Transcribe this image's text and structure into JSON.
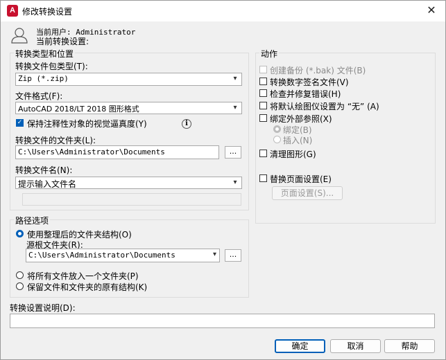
{
  "window": {
    "title": "修改转换设置",
    "app_icon_letter": "A",
    "close_glyph": "✕"
  },
  "user": {
    "current_user": "当前用户: Administrator",
    "current_setting": "当前转换设置:"
  },
  "left": {
    "group_title": "转换类型和位置",
    "package_type_label": "转换文件包类型(T):",
    "package_type_value": "Zip (*.zip)",
    "file_format_label": "文件格式(F):",
    "file_format_value": "AutoCAD 2018/LT 2018 图形格式",
    "keep_annotative_label": "保持注释性对象的视觉逼真度(Y)",
    "folder_label": "转换文件的文件夹(L):",
    "folder_value": "C:\\Users\\Administrator\\Documents",
    "browse_label": "...",
    "filename_label": "转换文件名(N):",
    "filename_value": "提示输入文件名"
  },
  "path": {
    "group_title": "路径选项",
    "organized_label": "使用整理后的文件夹结构(O)",
    "source_root_label": "源根文件夹(R):",
    "source_root_value": "C:\\Users\\Administrator\\Documents",
    "browse_label": "...",
    "single_folder_label": "将所有文件放入一个文件夹(P)",
    "keep_structure_label": "保留文件和文件夹的原有结构(K)"
  },
  "actions": {
    "group_title": "动作",
    "backup_label": "创建备份 (*.bak) 文件(B)",
    "sign_label": "转换数字签名文件(V)",
    "audit_label": "检查并修复错误(H)",
    "plotter_label": "将默认绘图仪设置为 “无” (A)",
    "bind_xref_label": "绑定外部参照(X)",
    "bind_label": "绑定(B)",
    "insert_label": "插入(N)",
    "purge_label": "清理图形(G)",
    "page_setup_label": "替换页面设置(E)",
    "page_setup_button": "页面设置(S)..."
  },
  "description": {
    "label": "转换设置说明(D):",
    "value": ""
  },
  "footer": {
    "ok": "确定",
    "cancel": "取消",
    "help": "帮助"
  },
  "colors": {
    "accent": "#005fb8",
    "app_red": "#c8102e"
  }
}
